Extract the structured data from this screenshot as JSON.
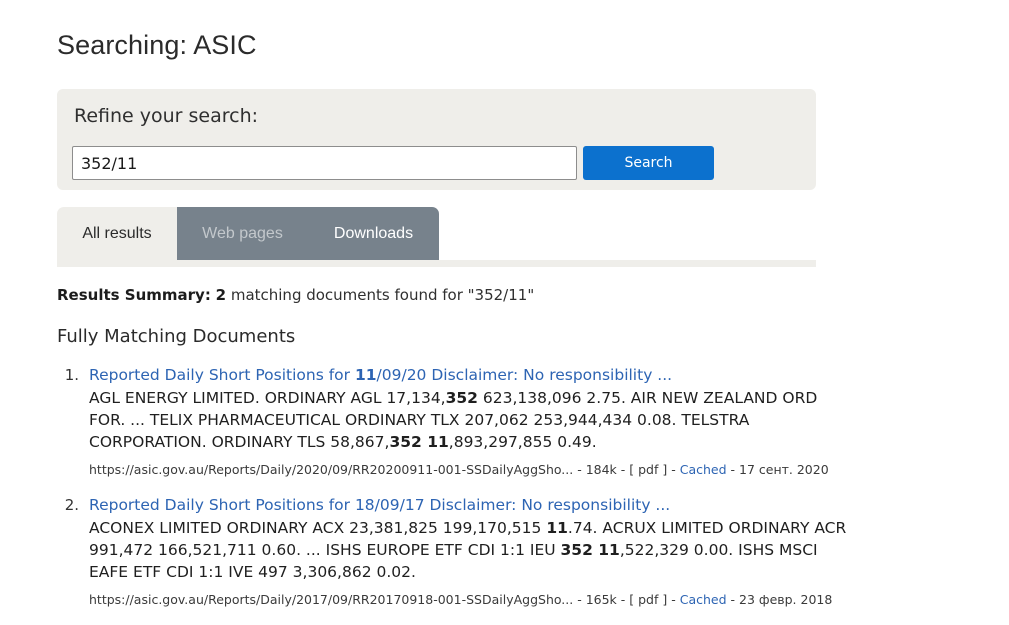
{
  "page": {
    "title": "Searching: ASIC"
  },
  "refine": {
    "label": "Refine your search:",
    "query_value": "352/11",
    "query_placeholder": "",
    "search_label": "Search"
  },
  "tabs": [
    {
      "label": "All results",
      "state": "active"
    },
    {
      "label": "Web pages",
      "state": "muted"
    },
    {
      "label": "Downloads",
      "state": "bright"
    }
  ],
  "summary": {
    "prefix": "Results Summary:",
    "count": "2",
    "text": " matching documents found for \"352/11\""
  },
  "section": {
    "heading": "Fully Matching Documents"
  },
  "results": [
    {
      "index": "1.",
      "title_parts": [
        {
          "text": "Reported Daily Short Positions for ",
          "bold": false
        },
        {
          "text": "11",
          "bold": true
        },
        {
          "text": "/09/20 Disclaimer: No responsibility ...",
          "bold": false
        }
      ],
      "title_plain": "Reported Daily Short Positions for 11/09/20 Disclaimer: No responsibility ...",
      "snippet_parts": [
        {
          "text": "AGL ENERGY LIMITED. ORDINARY AGL 17,134,",
          "bold": false
        },
        {
          "text": "352",
          "bold": true
        },
        {
          "text": " 623,138,096 2.75. AIR NEW ZEALAND ORD FOR. ... TELIX PHARMACEUTICAL ORDINARY TLX 207,062 253,944,434 0.08. TELSTRA CORPORATION. ORDINARY TLS 58,867,",
          "bold": false
        },
        {
          "text": "352 11",
          "bold": true
        },
        {
          "text": ",893,297,855 0.49.",
          "bold": false
        }
      ],
      "url": "https://asic.gov.au/Reports/Daily/2020/09/RR20200911-001-SSDailyAggSho...",
      "size": "184k",
      "filetype": "[ pdf ]",
      "cached_label": "Cached",
      "date": "17 сент. 2020"
    },
    {
      "index": "2.",
      "title_parts": [
        {
          "text": "Reported Daily Short Positions for 18/09/17 Disclaimer: No responsibility ...",
          "bold": false
        }
      ],
      "title_plain": "Reported Daily Short Positions for 18/09/17 Disclaimer: No responsibility ...",
      "snippet_parts": [
        {
          "text": "ACONEX LIMITED ORDINARY ACX 23,381,825 199,170,515 ",
          "bold": false
        },
        {
          "text": "11",
          "bold": true
        },
        {
          "text": ".74. ACRUX LIMITED ORDINARY ACR 991,472 166,521,711 0.60. ... ISHS EUROPE ETF CDI 1:1 IEU ",
          "bold": false
        },
        {
          "text": "352 11",
          "bold": true
        },
        {
          "text": ",522,329 0.00. ISHS MSCI EAFE ETF CDI 1:1 IVE 497 3,306,862 0.02.",
          "bold": false
        }
      ],
      "url": "https://asic.gov.au/Reports/Daily/2017/09/RR20170918-001-SSDailyAggSho...",
      "size": "165k",
      "filetype": "[ pdf ]",
      "cached_label": "Cached",
      "date": "23 февр. 2018"
    }
  ],
  "meta_separators": {
    "dash": " - "
  },
  "colors": {
    "accent_blue": "#0c71ce",
    "link_blue": "#2d64b3",
    "panel_bg": "#efeeea",
    "tab_gray": "#77828c"
  }
}
